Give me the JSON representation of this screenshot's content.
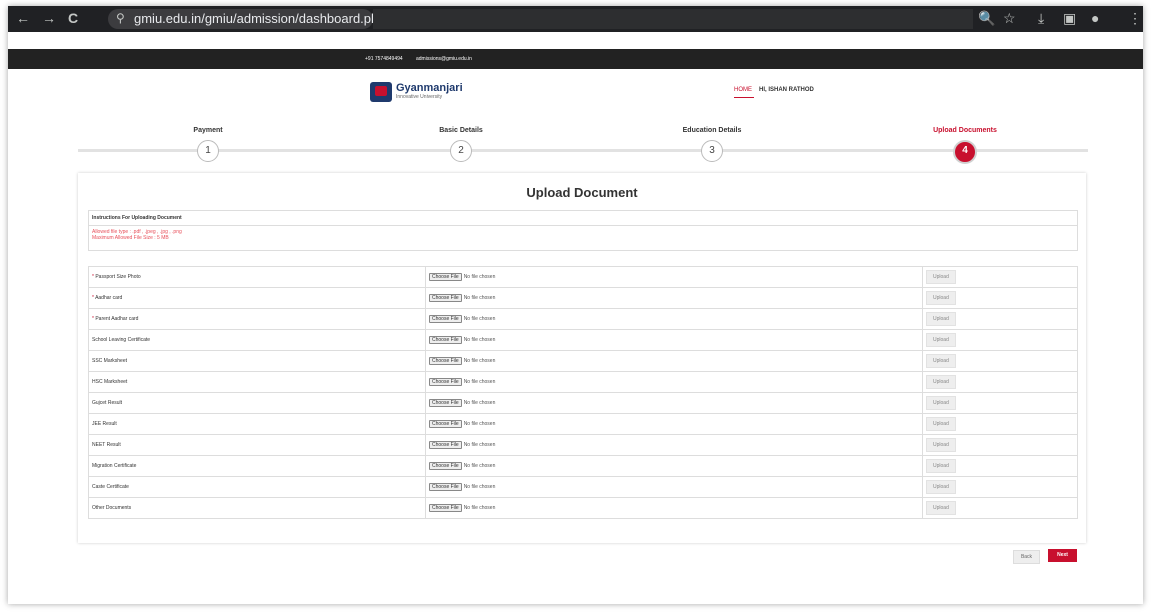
{
  "browser": {
    "url": "gmiu.edu.in/gmiu/admission/dashboard.php",
    "icons": {
      "back": "←",
      "forward": "→",
      "reload": "C",
      "site_info": "⚲",
      "zoom": "🔍",
      "star": "☆",
      "download": "⤓",
      "sidepanel": "▣",
      "profile": "●",
      "menu": "⋮"
    }
  },
  "contact": {
    "phone": "+91 7574849494",
    "email": "admissions@gmiu.edu.in"
  },
  "header": {
    "logo_name": "Gyanmanjari",
    "logo_sub": "Innovative University",
    "home": "HOME",
    "user": "HI, ISHAN RATHOD"
  },
  "steps": [
    {
      "label": "Payment",
      "num": "1",
      "active": false
    },
    {
      "label": "Basic Details",
      "num": "2",
      "active": false
    },
    {
      "label": "Education Details",
      "num": "3",
      "active": false
    },
    {
      "label": "Upload Documents",
      "num": "4",
      "active": true
    }
  ],
  "card": {
    "title": "Upload Document",
    "instructions_head": "Instructions For Uploading Document",
    "allowed": "Allowed file type : .pdf , .jpeg , .jpg , .png",
    "maxsize": "Maximum Allowed File Size : 5 MB"
  },
  "file_input": {
    "choose": "Choose File",
    "nofile": "No file chosen",
    "upload": "Upload"
  },
  "docs": [
    {
      "label": "Passport Size Photo",
      "required": true
    },
    {
      "label": "Aadhar card",
      "required": true
    },
    {
      "label": "Parent Aadhar card",
      "required": true
    },
    {
      "label": "School Leaving Certificate",
      "required": false
    },
    {
      "label": "SSC Marksheet",
      "required": false
    },
    {
      "label": "HSC Marksheet",
      "required": false
    },
    {
      "label": "Gujcet Result",
      "required": false
    },
    {
      "label": "JEE Result",
      "required": false
    },
    {
      "label": "NEET Result",
      "required": false
    },
    {
      "label": "Migration Certificate",
      "required": false
    },
    {
      "label": "Caste Certificate",
      "required": false
    },
    {
      "label": "Other Documents",
      "required": false
    }
  ],
  "actions": {
    "back": "Back",
    "next": "Next"
  },
  "colors": {
    "accent": "#c8102e",
    "brand_blue": "#1f3a6d"
  }
}
